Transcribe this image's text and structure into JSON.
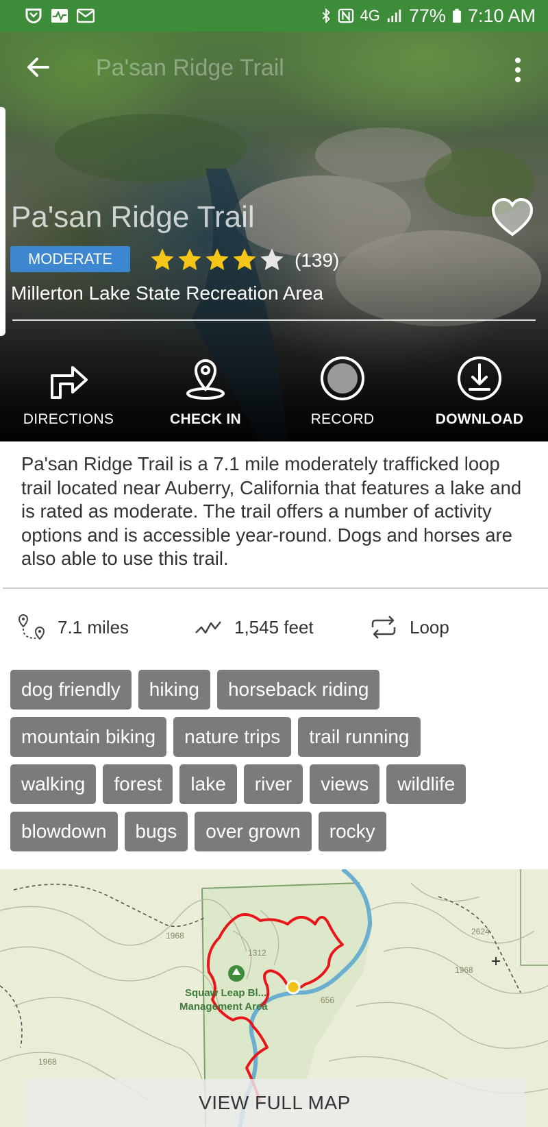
{
  "status_bar": {
    "network": "4G",
    "battery": "77%",
    "time": "7:10 AM",
    "icons": [
      "shield-icon",
      "activity-icon",
      "mail-icon",
      "bluetooth-icon",
      "nfc-icon",
      "signal-icon",
      "battery-icon"
    ]
  },
  "header": {
    "title": "Pa'san Ridge Trail",
    "back_icon": "arrow-left-icon",
    "menu_icon": "more-vertical-icon"
  },
  "trail": {
    "name": "Pa'san Ridge Trail",
    "difficulty": "MODERATE",
    "difficulty_color": "#3d87d0",
    "rating": 4.5,
    "max_rating": 5,
    "review_count": "(139)",
    "park": "Millerton Lake State Recreation Area",
    "favorite_icon": "heart-icon"
  },
  "actions": [
    {
      "label": "DIRECTIONS",
      "icon": "directions-icon"
    },
    {
      "label": "CHECK IN",
      "icon": "map-pin-icon"
    },
    {
      "label": "RECORD",
      "icon": "record-icon"
    },
    {
      "label": "DOWNLOAD",
      "icon": "download-icon"
    }
  ],
  "description": "Pa'san Ridge Trail is a 7.1 mile moderately trafficked loop trail located near Auberry, California that features a lake and is rated as moderate. The trail offers a number of activity options and is accessible year-round. Dogs and horses are also able to use this trail.",
  "stats": {
    "distance": "7.1 miles",
    "elevation": "1,545 feet",
    "route_type": "Loop"
  },
  "tags": [
    [
      "dog friendly",
      "hiking",
      "horseback riding"
    ],
    [
      "mountain biking",
      "nature trips",
      "trail running"
    ],
    [
      "walking",
      "forest",
      "lake",
      "river",
      "views",
      "wildlife"
    ],
    [
      "blowdown",
      "bugs",
      "over grown",
      "rocky"
    ]
  ],
  "map": {
    "area_label_1": "Squaw Leap Bl...",
    "area_label_2": "Management Area",
    "contour_labels": [
      "1968",
      "1312",
      "2624",
      "1968",
      "656",
      "1968"
    ],
    "view_full_map": "VIEW FULL MAP",
    "trail_color": "#e8161b",
    "water_color": "#6aaed0"
  }
}
